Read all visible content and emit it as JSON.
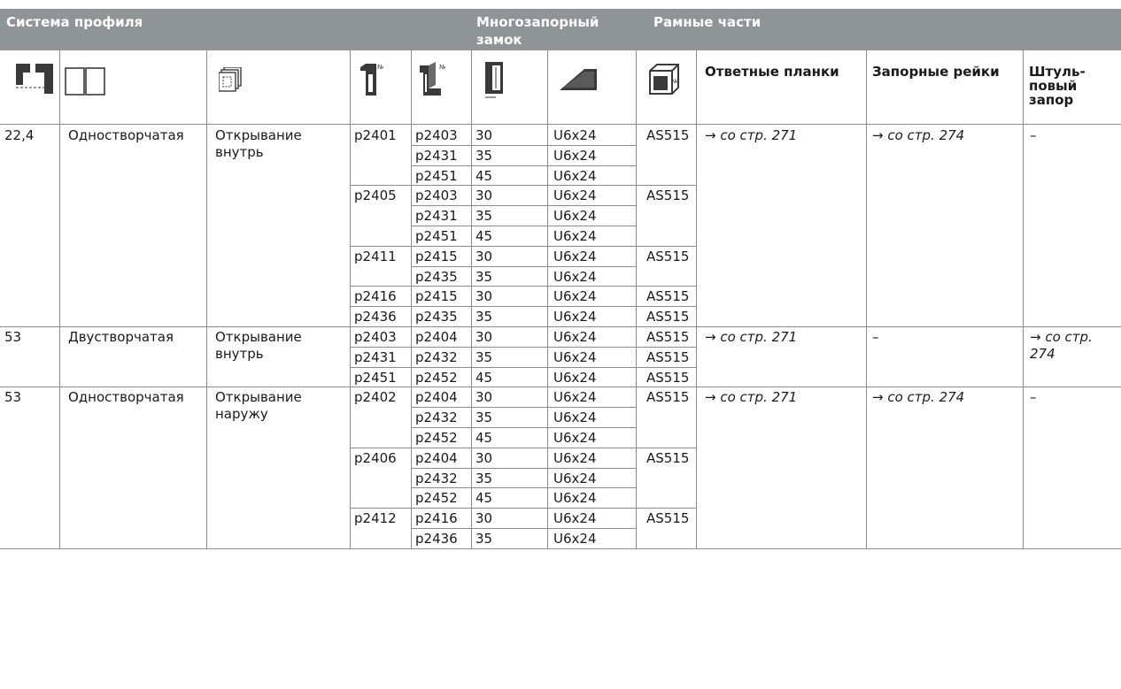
{
  "header": {
    "system": "Система профиля",
    "multilock_1": "Многозапорный",
    "multilock_2": "замок",
    "frame_parts": "Рамные части"
  },
  "icon_headers": [
    {
      "name": "profile-system-icon"
    },
    {
      "name": "window-type-icon"
    },
    {
      "name": "opening-type-icon"
    },
    {
      "name": "frame-profile-number-icon"
    },
    {
      "name": "sash-profile-number-icon"
    },
    {
      "name": "backset-icon"
    },
    {
      "name": "groove-icon"
    },
    {
      "name": "frame-part-number-icon"
    }
  ],
  "columns": {
    "strike_plates": "Ответные планки",
    "locking_bars": "Запорные рейки",
    "shtulp_1": "Штуль-",
    "shtulp_2": "повый",
    "shtulp_3": "запор"
  },
  "groups": [
    {
      "system": "22,4",
      "type": "Одностворчатая",
      "open_1": "Открывание",
      "open_2": "внутрь",
      "strike": "→ со стр. 271",
      "bars": "→ со стр. 274",
      "shtulp_1": "–",
      "shtulp_2": "",
      "frames": [
        {
          "frame": "p2401",
          "part": "AS515",
          "rows": [
            [
              "p2403",
              "30",
              "U6x24"
            ],
            [
              "p2431",
              "35",
              "U6x24"
            ],
            [
              "p2451",
              "45",
              "U6x24"
            ]
          ]
        },
        {
          "frame": "p2405",
          "part": "AS515",
          "rows": [
            [
              "p2403",
              "30",
              "U6x24"
            ],
            [
              "p2431",
              "35",
              "U6x24"
            ],
            [
              "p2451",
              "45",
              "U6x24"
            ]
          ]
        },
        {
          "frame": "p2411",
          "part": "AS515",
          "rows": [
            [
              "p2415",
              "30",
              "U6x24"
            ],
            [
              "p2435",
              "35",
              "U6x24"
            ]
          ]
        },
        {
          "frame": "p2416",
          "part": "AS515",
          "rows": [
            [
              "p2415",
              "30",
              "U6x24"
            ]
          ]
        },
        {
          "frame": "p2436",
          "part": "AS515",
          "rows": [
            [
              "p2435",
              "35",
              "U6x24"
            ]
          ]
        }
      ]
    },
    {
      "system": "53",
      "type": "Двустворчатая",
      "open_1": "Открывание",
      "open_2": "внутрь",
      "strike": "→ со стр. 271",
      "bars": "–",
      "shtulp_1": "→ со стр.",
      "shtulp_2": "274",
      "frames": [
        {
          "frame": "p2403",
          "part": "AS515",
          "rows": [
            [
              "p2404",
              "30",
              "U6x24"
            ]
          ]
        },
        {
          "frame": "p2431",
          "part": "AS515",
          "rows": [
            [
              "p2432",
              "35",
              "U6x24"
            ]
          ]
        },
        {
          "frame": "p2451",
          "part": "AS515",
          "rows": [
            [
              "p2452",
              "45",
              "U6x24"
            ]
          ]
        }
      ]
    },
    {
      "system": "53",
      "type": "Одностворчатая",
      "open_1": "Открывание",
      "open_2": "наружу",
      "strike": "→ со стр. 271",
      "bars": "→ со стр. 274",
      "shtulp_1": "–",
      "shtulp_2": "",
      "frames": [
        {
          "frame": "p2402",
          "part": "AS515",
          "rows": [
            [
              "p2404",
              "30",
              "U6x24"
            ],
            [
              "p2432",
              "35",
              "U6x24"
            ],
            [
              "p2452",
              "45",
              "U6x24"
            ]
          ]
        },
        {
          "frame": "p2406",
          "part": "AS515",
          "rows": [
            [
              "p2404",
              "30",
              "U6x24"
            ],
            [
              "p2432",
              "35",
              "U6x24"
            ],
            [
              "p2452",
              "45",
              "U6x24"
            ]
          ]
        },
        {
          "frame": "p2412",
          "part": "AS515",
          "rows": [
            [
              "p2416",
              "30",
              "U6x24"
            ],
            [
              "p2436",
              "35",
              "U6x24"
            ]
          ]
        }
      ]
    }
  ]
}
